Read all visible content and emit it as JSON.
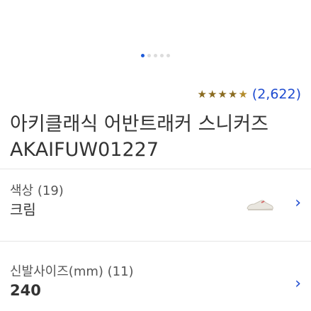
{
  "carousel": {
    "count": 5,
    "active": 0
  },
  "rating": {
    "stars": [
      "★",
      "★",
      "★",
      "★",
      "★"
    ],
    "value": 4.5,
    "count_text": "(2,622)"
  },
  "product": {
    "title": "아키클래식 어반트래커 스니커즈 AKAIFUW01227"
  },
  "color_option": {
    "label": "색상 (19)",
    "value": "크림",
    "thumb_icon": "sneaker-thumbnail-icon"
  },
  "size_option": {
    "label": "신발사이즈(mm) (11)",
    "value": "240"
  },
  "colors": {
    "accent": "#1e4bd0",
    "star": "#8a6b20"
  }
}
